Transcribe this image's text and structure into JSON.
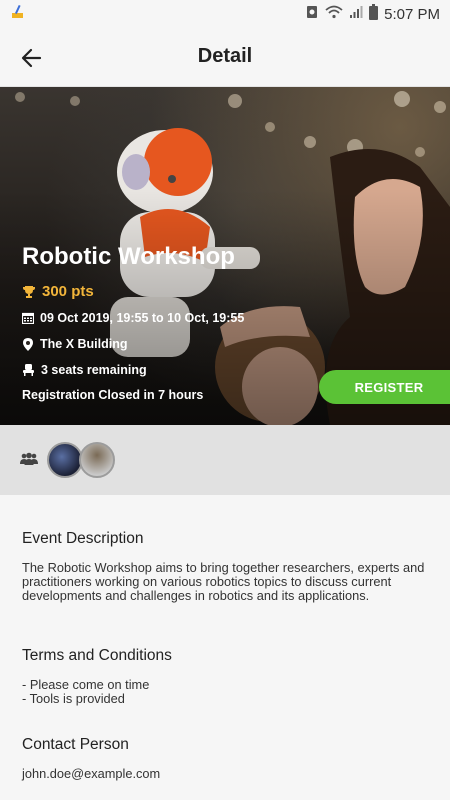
{
  "status_bar": {
    "time": "5:07 PM",
    "icons": [
      "broom-icon",
      "sync-icon",
      "wifi-icon",
      "signal-icon",
      "battery-icon"
    ]
  },
  "app_bar": {
    "title": "Detail",
    "back_icon": "arrow-left-icon"
  },
  "event": {
    "title": "Robotic Workshop",
    "points": "300 pts",
    "date": "09 Oct 2019, 19:55 to 10 Oct, 19:55",
    "location": "The X Building",
    "seats": "3 seats remaining",
    "registration": "Registration Closed in 7 hours",
    "register_label": "REGISTER"
  },
  "participants": {
    "icon": "group-icon",
    "avatars": [
      "participant-avatar-1",
      "participant-avatar-2"
    ]
  },
  "description": {
    "heading": "Event Description",
    "body": "The Robotic Workshop aims to bring together researchers, experts and practitioners working on various robotics topics to discuss current developments and challenges in robotics and its applications."
  },
  "terms": {
    "heading": "Terms and Conditions",
    "items": [
      "- Please come on time",
      "- Tools is provided"
    ]
  },
  "contact": {
    "heading": "Contact Person",
    "email": "john.doe@example.com"
  },
  "colors": {
    "accent_green": "#5bc236",
    "points_gold": "#f2b53a",
    "participants_bg": "#e1e1e1"
  }
}
